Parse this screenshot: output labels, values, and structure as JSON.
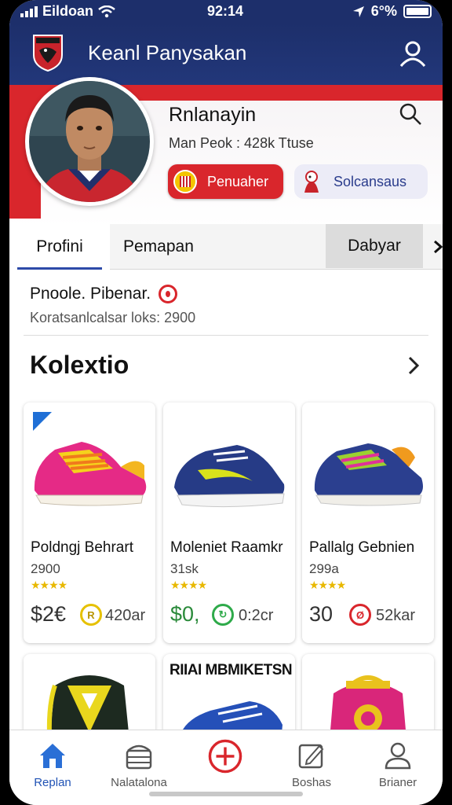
{
  "status_bar": {
    "carrier": "Eildoan",
    "time": "92:14",
    "battery": "6°%"
  },
  "header": {
    "title": "Keanl Panysakan"
  },
  "profile": {
    "name": "Rnlanayin",
    "meta": "Man Peok : 428k Ttuse",
    "team_pill": "Penuaher",
    "club_pill": "Solcansaus"
  },
  "tabs": [
    {
      "label": "Profini"
    },
    {
      "label": "Pemapan"
    },
    {
      "label": "Dabyar"
    }
  ],
  "info": {
    "title": "Pnoole. Pibenar.",
    "subtitle": "Koratsanlcalsar loks: 2900"
  },
  "collection": {
    "title": "Kolextio",
    "products": [
      {
        "name": "Poldngj Behrart",
        "sub": "2900",
        "stars": "★★★★",
        "price": "$2€",
        "coin_label": "R",
        "points": "420ar",
        "coin_color": "#e6c100"
      },
      {
        "name": "Moleniet Raamkr",
        "sub": "31sk",
        "stars": "★★★★",
        "price": "$0,",
        "coin_label": "↻",
        "points": "0:2cr",
        "coin_color": "#2eaa4a"
      },
      {
        "name": "Pallalg Gebnien",
        "sub": "299a",
        "stars": "★★★★",
        "price": "30",
        "coin_label": "Ø",
        "points": "52kar",
        "coin_color": "#d9262c"
      }
    ],
    "second_row": [
      {
        "title": ""
      },
      {
        "title": "RIIAI MBMIKETSN"
      },
      {
        "title": ""
      }
    ]
  },
  "bottom_nav": [
    {
      "label": "Replan"
    },
    {
      "label": "Nalatalona"
    },
    {
      "label": ""
    },
    {
      "label": "Boshas"
    },
    {
      "label": "Brianer"
    }
  ],
  "colors": {
    "navy": "#1d2f6b",
    "accent_red": "#d9262c",
    "nav_active": "#2153b5",
    "star": "#e8b800"
  }
}
